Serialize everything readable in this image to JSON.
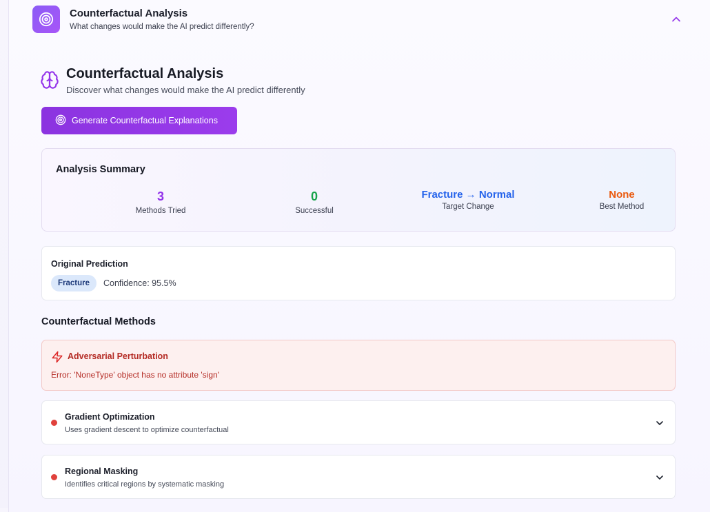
{
  "header": {
    "title": "Counterfactual Analysis",
    "subtitle": "What changes would make the AI predict differently?",
    "icon": "target-icon",
    "collapse_icon": "chevron-up-icon"
  },
  "section": {
    "title": "Counterfactual Analysis",
    "subtitle": "Discover what changes would make the AI predict differently",
    "icon": "brain-icon"
  },
  "generate_button": {
    "label": "Generate Counterfactual Explanations",
    "icon": "target-icon"
  },
  "summary": {
    "title": "Analysis Summary",
    "stats": [
      {
        "value": "3",
        "label": "Methods Tried",
        "color": "#9333ea"
      },
      {
        "value": "0",
        "label": "Successful",
        "color": "#16a34a"
      },
      {
        "value": "Fracture → Normal",
        "label": "Target Change",
        "color": "#2563eb"
      },
      {
        "value": "None",
        "label": "Best Method",
        "color": "#ea580c"
      }
    ]
  },
  "original": {
    "title": "Original Prediction",
    "badge": "Fracture",
    "confidence": "Confidence: 95.5%"
  },
  "methods": {
    "title": "Counterfactual Methods",
    "error": {
      "title": "Adversarial Perturbation",
      "message": "Error: 'NoneType' object has no attribute 'sign'",
      "icon": "lightning-icon"
    },
    "items": [
      {
        "title": "Gradient Optimization",
        "desc": "Uses gradient descent to optimize counterfactual",
        "status_color": "#e0413c"
      },
      {
        "title": "Regional Masking",
        "desc": "Identifies critical regions by systematic masking",
        "status_color": "#e0413c"
      }
    ]
  },
  "colors": {
    "accent": "#9333ea",
    "error": "#b42b24"
  }
}
